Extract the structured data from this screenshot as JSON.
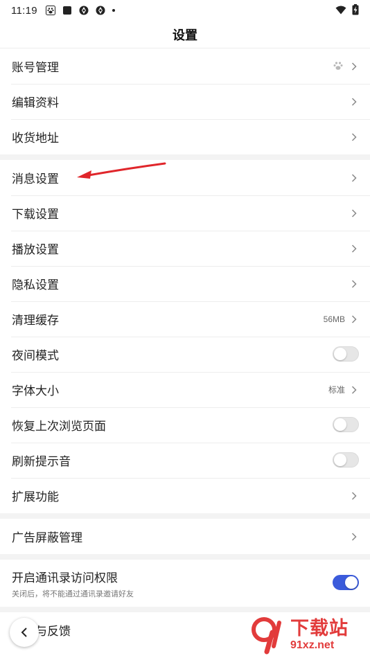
{
  "status_bar": {
    "time": "11:19",
    "icons": [
      "baidu-paw-icon",
      "square-notification-icon",
      "aperture-icon",
      "aperture-icon",
      "dot-icon"
    ],
    "right_icons": [
      "wifi-icon",
      "battery-charging-icon"
    ]
  },
  "header": {
    "title": "设置"
  },
  "group1": [
    {
      "label": "账号管理",
      "trailing_icon": "baidu-paw-icon"
    },
    {
      "label": "编辑资料"
    },
    {
      "label": "收货地址"
    }
  ],
  "group2": [
    {
      "label": "消息设置"
    },
    {
      "label": "下载设置"
    },
    {
      "label": "播放设置"
    },
    {
      "label": "隐私设置"
    },
    {
      "label": "清理缓存",
      "value": "56MB"
    },
    {
      "label": "夜间模式",
      "toggle": false
    },
    {
      "label": "字体大小",
      "value": "标准"
    },
    {
      "label": "恢复上次浏览页面",
      "toggle": false
    },
    {
      "label": "刷新提示音",
      "toggle": false
    },
    {
      "label": "扩展功能"
    }
  ],
  "group3": [
    {
      "label": "广告屏蔽管理"
    }
  ],
  "group4": {
    "label": "开启通讯录访问权限",
    "sub": "关闭后，将不能通过通讯录邀请好友",
    "toggle": true
  },
  "group5": [
    {
      "label": "帮助与反馈"
    }
  ],
  "annotation": {
    "color": "#e0262b"
  },
  "watermark": {
    "big": "下载站",
    "small": "91xz.net",
    "color": "#e23b3b"
  },
  "colors": {
    "accent": "#3b5bdb",
    "separator": "#f3f3f3"
  }
}
